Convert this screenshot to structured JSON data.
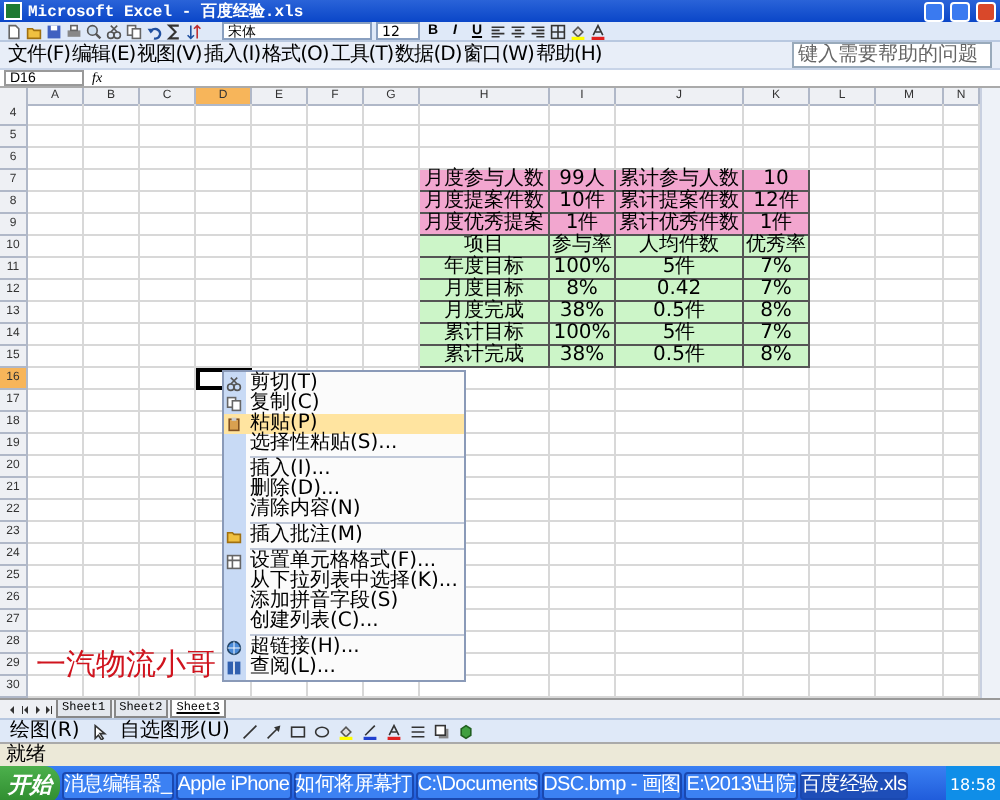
{
  "window": {
    "title": "Microsoft Excel - 百度经验.xls"
  },
  "toolbar": {
    "font": "宋体",
    "size": "12",
    "bold": "B",
    "italic": "I",
    "underline": "U"
  },
  "menu_bar": [
    "文件(F)",
    "编辑(E)",
    "视图(V)",
    "插入(I)",
    "格式(O)",
    "工具(T)",
    "数据(D)",
    "窗口(W)",
    "帮助(H)"
  ],
  "help_box": {
    "placeholder": "键入需要帮助的问题"
  },
  "name_box": "D16",
  "function_label": "fx",
  "columns": [
    {
      "label": "A",
      "selected": false
    },
    {
      "label": "B",
      "selected": false
    },
    {
      "label": "C",
      "selected": false
    },
    {
      "label": "D",
      "selected": true
    },
    {
      "label": "E",
      "selected": false
    },
    {
      "label": "F",
      "selected": false
    },
    {
      "label": "G",
      "selected": false
    },
    {
      "label": "H",
      "selected": false
    },
    {
      "label": "I",
      "selected": false
    },
    {
      "label": "J",
      "selected": false
    },
    {
      "label": "K",
      "selected": false
    },
    {
      "label": "L",
      "selected": false
    },
    {
      "label": "M",
      "selected": false
    },
    {
      "label": "N",
      "selected": false
    }
  ],
  "rows": [
    {
      "number": "4",
      "selected": false
    },
    {
      "number": "5",
      "selected": false
    },
    {
      "number": "6",
      "selected": false
    },
    {
      "number": "7",
      "selected": false
    },
    {
      "number": "8",
      "selected": false
    },
    {
      "number": "9",
      "selected": false
    },
    {
      "number": "10",
      "selected": false
    },
    {
      "number": "11",
      "selected": false
    },
    {
      "number": "12",
      "selected": false
    },
    {
      "number": "13",
      "selected": false
    },
    {
      "number": "14",
      "selected": false
    },
    {
      "number": "15",
      "selected": false
    },
    {
      "number": "16",
      "selected": true
    },
    {
      "number": "17",
      "selected": false
    },
    {
      "number": "18",
      "selected": false
    },
    {
      "number": "19",
      "selected": false
    },
    {
      "number": "20",
      "selected": false
    },
    {
      "number": "21",
      "selected": false
    },
    {
      "number": "22",
      "selected": false
    },
    {
      "number": "23",
      "selected": false
    },
    {
      "number": "24",
      "selected": false
    },
    {
      "number": "25",
      "selected": false
    },
    {
      "number": "26",
      "selected": false
    },
    {
      "number": "27",
      "selected": false
    },
    {
      "number": "28",
      "selected": false
    },
    {
      "number": "29",
      "selected": false
    },
    {
      "number": "30",
      "selected": false
    }
  ],
  "table": {
    "rows": [
      {
        "kind": "summary",
        "cells": [
          "月度参与人数",
          "99人",
          "累计参与人数",
          "10"
        ]
      },
      {
        "kind": "summary",
        "cells": [
          "月度提案件数",
          "10件",
          "累计提案件数",
          "12件"
        ]
      },
      {
        "kind": "summary",
        "cells": [
          "月度优秀提案",
          "1件",
          "累计优秀件数",
          "1件"
        ]
      },
      {
        "kind": "metric",
        "cells": [
          "项目",
          "参与率",
          "人均件数",
          "优秀率"
        ]
      },
      {
        "kind": "metric",
        "cells": [
          "年度目标",
          "100%",
          "5件",
          "7%"
        ]
      },
      {
        "kind": "metric",
        "cells": [
          "月度目标",
          "8%",
          "0.42",
          "7%"
        ]
      },
      {
        "kind": "metric",
        "cells": [
          "月度完成",
          "38%",
          "0.5件",
          "8%"
        ]
      },
      {
        "kind": "metric",
        "cells": [
          "累计目标",
          "100%",
          "5件",
          "7%"
        ]
      },
      {
        "kind": "metric",
        "cells": [
          "累计完成",
          "38%",
          "0.5件",
          "8%"
        ]
      }
    ]
  },
  "note": "一汽物流小哥",
  "context_menu": {
    "groups": [
      [
        {
          "label": "剪切(T)",
          "selected": false
        },
        {
          "label": "复制(C)",
          "selected": false
        },
        {
          "label": "粘贴(P)",
          "selected": true
        },
        {
          "label": "选择性粘贴(S)...",
          "selected": false
        }
      ],
      [
        {
          "label": "插入(I)...",
          "selected": false
        },
        {
          "label": "删除(D)...",
          "selected": false
        },
        {
          "label": "清除内容(N)",
          "selected": false
        }
      ],
      [
        {
          "label": "插入批注(M)",
          "selected": false
        }
      ],
      [
        {
          "label": "设置单元格格式(F)...",
          "selected": false
        },
        {
          "label": "从下拉列表中选择(K)...",
          "selected": false
        },
        {
          "label": "添加拼音字段(S)",
          "selected": false
        },
        {
          "label": "创建列表(C)...",
          "selected": false
        }
      ],
      [
        {
          "label": "超链接(H)...",
          "selected": false
        },
        {
          "label": "查阅(L)...",
          "selected": false
        }
      ]
    ]
  },
  "sheet_tabs": [
    {
      "label": "Sheet1",
      "selected": false
    },
    {
      "label": "Sheet2",
      "selected": false
    },
    {
      "label": "Sheet3",
      "selected": true
    }
  ],
  "drawing_toolbar": [
    "绘图(R)",
    "自选图形(U)"
  ],
  "status_bar": "就绪",
  "taskbar": {
    "start": "开始",
    "buttons": [
      {
        "label": "消息编辑器_",
        "selected": false
      },
      {
        "label": "Apple iPhone",
        "selected": false
      },
      {
        "label": "如何将屏幕打",
        "selected": false
      },
      {
        "label": "C:\\Documents",
        "selected": false
      },
      {
        "label": "DSC.bmp - 画图",
        "selected": false
      },
      {
        "label": "E:\\2013\\出院",
        "selected": false
      },
      {
        "label": "百度经验.xls",
        "selected": true
      }
    ],
    "clock": "18:58"
  }
}
